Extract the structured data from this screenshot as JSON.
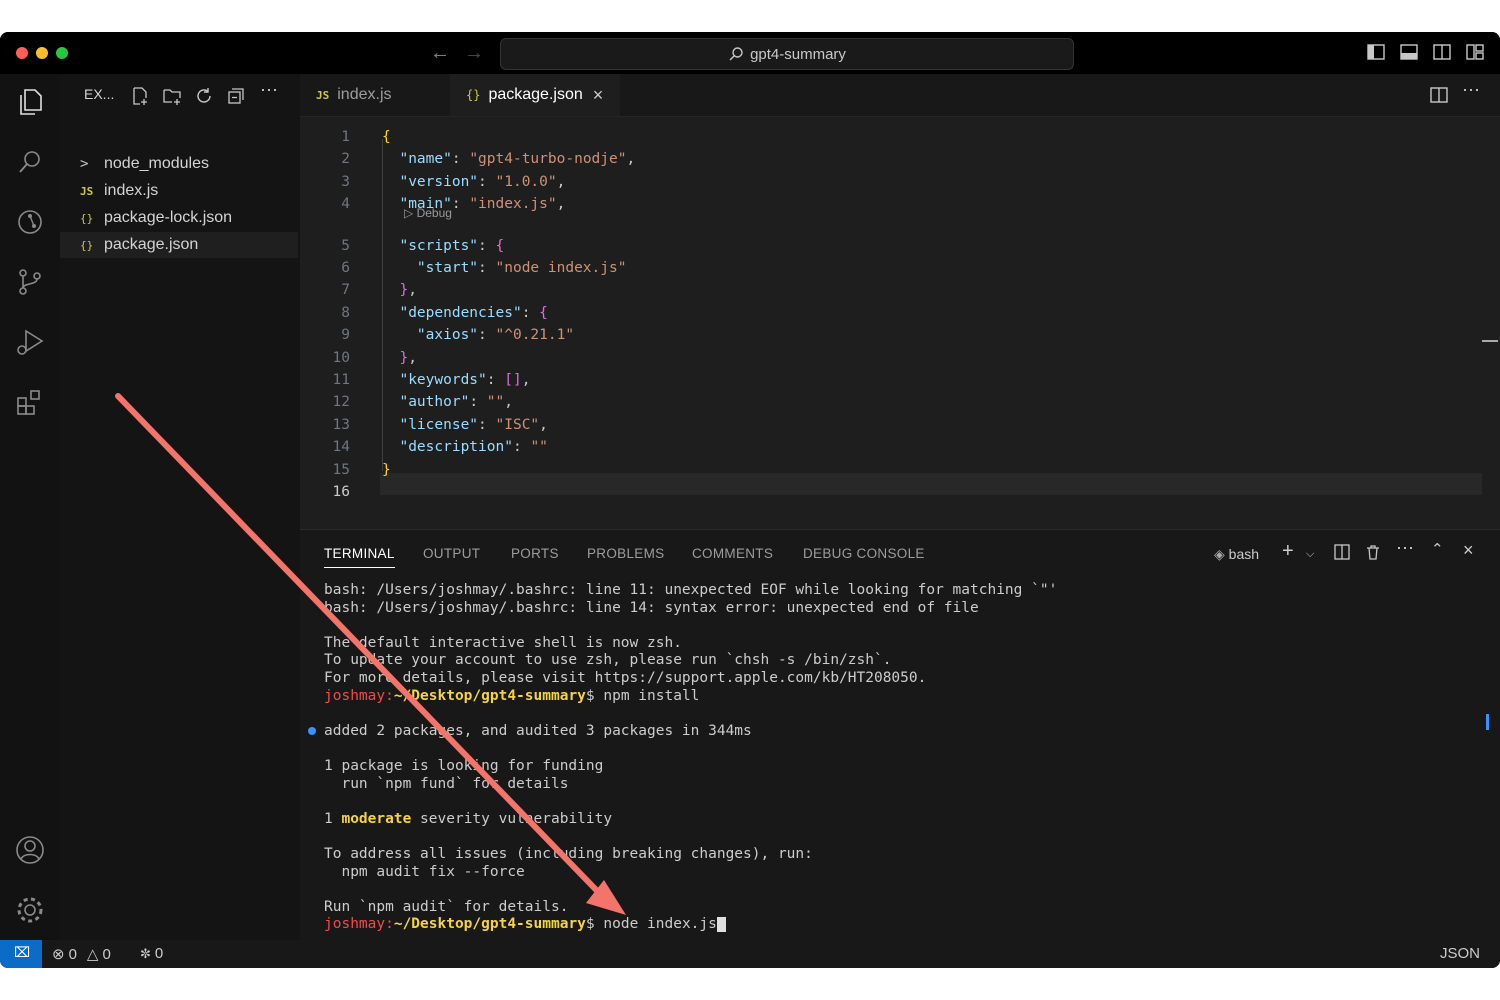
{
  "title_bar": {
    "search_text": "gpt4-summary"
  },
  "sidebar": {
    "header": "EX...",
    "items": [
      {
        "label": "node_modules",
        "icon": ">"
      },
      {
        "label": "index.js",
        "icon": "JS"
      },
      {
        "label": "package-lock.json",
        "icon": "{}"
      },
      {
        "label": "package.json",
        "icon": "{}"
      }
    ]
  },
  "tabs": [
    {
      "label": "index.js",
      "icon": "JS"
    },
    {
      "label": "package.json",
      "icon": "{}"
    }
  ],
  "editor": {
    "line_numbers": [
      "1",
      "2",
      "3",
      "4",
      "5",
      "6",
      "7",
      "8",
      "9",
      "10",
      "11",
      "12",
      "13",
      "14",
      "15",
      "16"
    ],
    "codelens": "Debug",
    "lines": [
      {
        "indent": "",
        "key": "",
        "val": "",
        "open": "{",
        "close": ""
      },
      {
        "indent": "  ",
        "key": "\"name\"",
        "val": "\"gpt4-turbo-nodje\"",
        "open": "",
        "close": ","
      },
      {
        "indent": "  ",
        "key": "\"version\"",
        "val": "\"1.0.0\"",
        "open": "",
        "close": ","
      },
      {
        "indent": "  ",
        "key": "\"main\"",
        "val": "\"index.js\"",
        "open": "",
        "close": ","
      },
      {
        "indent": "  ",
        "key": "\"scripts\"",
        "val": "",
        "open": "{",
        "close": ""
      },
      {
        "indent": "    ",
        "key": "\"start\"",
        "val": "\"node index.js\"",
        "open": "",
        "close": ""
      },
      {
        "indent": "  ",
        "key": "",
        "val": "",
        "open": "}",
        "close": ","
      },
      {
        "indent": "  ",
        "key": "\"dependencies\"",
        "val": "",
        "open": "{",
        "close": ""
      },
      {
        "indent": "    ",
        "key": "\"axios\"",
        "val": "\"^0.21.1\"",
        "open": "",
        "close": ""
      },
      {
        "indent": "  ",
        "key": "",
        "val": "",
        "open": "}",
        "close": ","
      },
      {
        "indent": "  ",
        "key": "\"keywords\"",
        "val": "",
        "open": "[]",
        "close": ","
      },
      {
        "indent": "  ",
        "key": "\"author\"",
        "val": "\"\"",
        "open": "",
        "close": ","
      },
      {
        "indent": "  ",
        "key": "\"license\"",
        "val": "\"ISC\"",
        "open": "",
        "close": ","
      },
      {
        "indent": "  ",
        "key": "\"description\"",
        "val": "\"\"",
        "open": "",
        "close": ""
      },
      {
        "indent": "",
        "key": "",
        "val": "",
        "open": "}",
        "close": ""
      },
      {
        "indent": "",
        "key": "",
        "val": "",
        "open": "",
        "close": ""
      }
    ]
  },
  "panel": {
    "tabs": [
      "TERMINAL",
      "OUTPUT",
      "PORTS",
      "PROBLEMS",
      "COMMENTS",
      "DEBUG CONSOLE"
    ],
    "shell_label": "bash",
    "terminal_lines": [
      "bash: /Users/joshmay/.bashrc: line 11: unexpected EOF while looking for matching `\"'",
      "bash: /Users/joshmay/.bashrc: line 14: syntax error: unexpected end of file",
      "",
      "The default interactive shell is now zsh.",
      "To update your account to use zsh, please run `chsh -s /bin/zsh`.",
      "For more details, please visit https://support.apple.com/kb/HT208050."
    ],
    "prompt_user": "joshmay:",
    "prompt_path": "~/Desktop/gpt4-summary",
    "prompt_suffix": "$ ",
    "command1": "npm install",
    "output_lines": [
      "",
      "added 2 packages, and audited 3 packages in 344ms",
      "",
      "1 package is looking for funding",
      "  run `npm fund` for details",
      ""
    ],
    "vuln_prefix": "1 ",
    "vuln_word": "moderate",
    "vuln_suffix": " severity vulnerability",
    "output_lines2": [
      "",
      "To address all issues (including breaking changes), run:",
      "  npm audit fix --force",
      "",
      "Run `npm audit` for details."
    ],
    "command2": "node index.js"
  },
  "status_bar": {
    "errors": "0",
    "warnings": "0",
    "ports": "0",
    "language": "JSON"
  }
}
